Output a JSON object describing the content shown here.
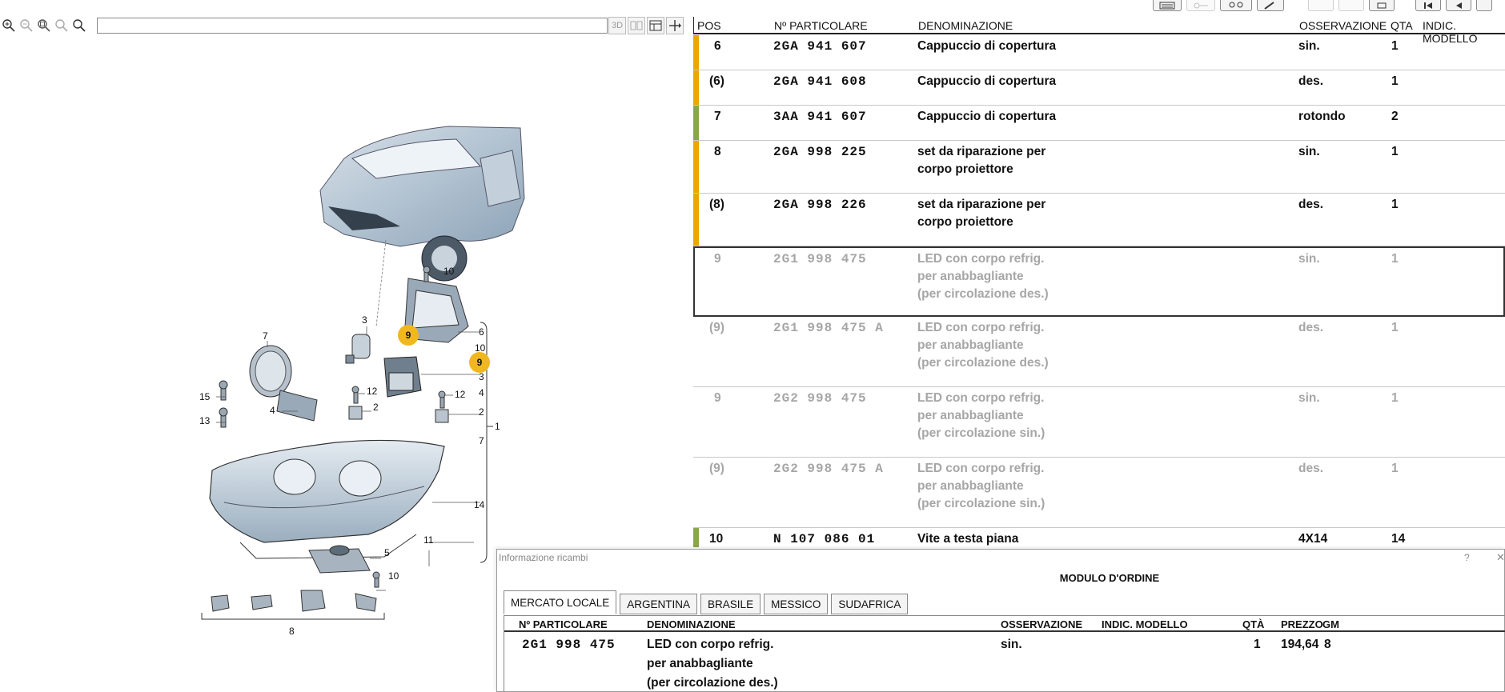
{
  "viewer": {
    "toolbar": {
      "btn_3d": "3D"
    }
  },
  "diagram_callouts": [
    "10",
    "3",
    "9",
    "6",
    "10",
    "9",
    "3",
    "4",
    "7",
    "15",
    "12",
    "2",
    "12",
    "2",
    "1",
    "13",
    "7",
    "4",
    "14",
    "11",
    "5",
    "10",
    "8"
  ],
  "parts_table": {
    "columns": {
      "pos": "POS",
      "part_no": "Nº PARTICOLARE",
      "name": "DENOMINAZIONE",
      "note": "OSSERVAZIONE",
      "qty": "QTA",
      "model": "INDIC. MODELLO"
    },
    "rows": [
      {
        "pos": "6",
        "part": "2GA  941  607",
        "name": [
          "Cappuccio di copertura"
        ],
        "note": "sin.",
        "qty": "1",
        "bar": "#e8a800",
        "dim": false
      },
      {
        "pos": "(6)",
        "part": "2GA  941  608",
        "name": [
          "Cappuccio di copertura"
        ],
        "note": "des.",
        "qty": "1",
        "bar": "#e8a800",
        "dim": false
      },
      {
        "pos": "7",
        "part": "3AA  941  607",
        "name": [
          "Cappuccio di copertura"
        ],
        "note": "rotondo",
        "qty": "2",
        "bar": "#8aa64a",
        "dim": false
      },
      {
        "pos": "8",
        "part": "2GA  998  225",
        "name": [
          "set da riparazione per",
          "corpo proiettore"
        ],
        "note": "sin.",
        "qty": "1",
        "bar": "#e8a800",
        "dim": false
      },
      {
        "pos": "(8)",
        "part": "2GA  998  226",
        "name": [
          "set da riparazione per",
          "corpo proiettore"
        ],
        "note": "des.",
        "qty": "1",
        "bar": "#e8a800",
        "dim": false
      },
      {
        "pos": "9",
        "part": "2G1  998  475",
        "name": [
          "LED con corpo refrig.",
          "per anabbagliante",
          "(per circolazione des.)"
        ],
        "note": "sin.",
        "qty": "1",
        "bar": "",
        "dim": true
      },
      {
        "pos": "(9)",
        "part": "2G1  998  475  A",
        "name": [
          "LED con corpo refrig.",
          "per anabbagliante",
          "(per circolazione des.)"
        ],
        "note": "des.",
        "qty": "1",
        "bar": "",
        "dim": true
      },
      {
        "pos": "9",
        "part": "2G2  998  475",
        "name": [
          "LED con corpo refrig.",
          "per anabbagliante",
          "(per circolazione sin.)"
        ],
        "note": "sin.",
        "qty": "1",
        "bar": "",
        "dim": true
      },
      {
        "pos": "(9)",
        "part": "2G2  998  475  A",
        "name": [
          "LED con corpo refrig.",
          "per anabbagliante",
          "(per circolazione sin.)"
        ],
        "note": "des.",
        "qty": "1",
        "bar": "",
        "dim": true
      },
      {
        "pos": "10",
        "part": "N    107  086  01",
        "name": [
          "Vite a testa piana"
        ],
        "note": "4X14",
        "qty": "14",
        "bar": "#8aa64a",
        "dim": false
      }
    ]
  },
  "popup": {
    "title": "Informazione ricambi",
    "help": "?",
    "close": "✕",
    "heading": "MODULO D'ORDINE",
    "tabs": [
      "MERCATO LOCALE",
      "ARGENTINA",
      "BRASILE",
      "MESSICO",
      "SUDAFRICA"
    ],
    "columns": {
      "part_no": "Nº PARTICOLARE",
      "name": "DENOMINAZIONE",
      "note": "OSSERVAZIONE",
      "model": "INDIC. MODELLO",
      "qty": "QTÀ",
      "price": "PREZZO",
      "gm": "GM"
    },
    "row": {
      "part": "2G1  998  475",
      "name": [
        "LED con corpo refrig.",
        "per anabbagliante",
        "(per circolazione des.)"
      ],
      "note": "sin.",
      "qty": "1",
      "price": "194,64",
      "gm": "8"
    }
  },
  "colors": {
    "highlight_callout": "#f0b81e",
    "bar_orange": "#e8a800",
    "bar_green": "#8aa64a"
  }
}
